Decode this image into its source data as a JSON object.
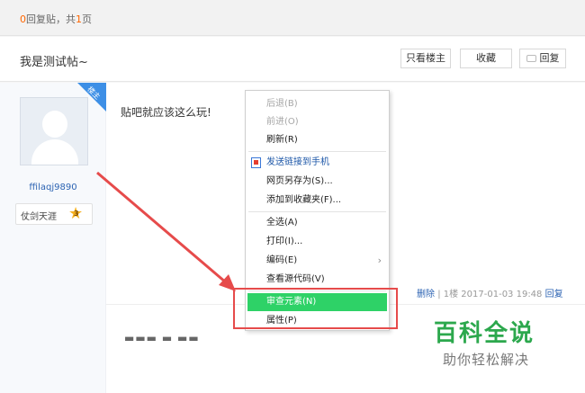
{
  "summary": {
    "reply_count": "0",
    "reply_label": "回复贴，共",
    "page_count": "1",
    "page_label": "页"
  },
  "thread": {
    "title": "我是测试帖~",
    "only_owner_label": "只看楼主",
    "favorite_label": "收藏",
    "reply_label": "回复"
  },
  "author": {
    "badge": "楼主",
    "username": "ffilaqj9890",
    "rank_title": "仗剑天涯",
    "rank_level": "3"
  },
  "post": {
    "text": "贴吧就应该这么玩!",
    "delete_label": "删除",
    "floor": "| 1楼",
    "timestamp": "2017-01-03 19:48",
    "reply_label": "回复"
  },
  "context_menu": {
    "items": [
      {
        "label": "后退(B)",
        "state": "disabled"
      },
      {
        "label": "前进(O)",
        "state": "disabled"
      },
      {
        "label": "刷新(R)",
        "state": "normal"
      },
      {
        "label": "发送链接到手机",
        "state": "link",
        "icon": "phone-icon"
      },
      {
        "label": "网页另存为(S)...",
        "state": "normal"
      },
      {
        "label": "添加到收藏夹(F)...",
        "state": "normal"
      },
      {
        "label": "全选(A)",
        "state": "normal"
      },
      {
        "label": "打印(I)...",
        "state": "normal"
      },
      {
        "label": "编码(E)",
        "state": "normal",
        "submenu": "›"
      },
      {
        "label": "查看源代码(V)",
        "state": "normal"
      },
      {
        "label": "审查元素(N)",
        "state": "selected"
      },
      {
        "label": "属性(P)",
        "state": "normal"
      }
    ]
  },
  "watermark": {
    "main": "百科全说",
    "sub": "助你轻松解决"
  },
  "colors": {
    "accent_green": "#2ed267",
    "highlight_red": "#e64b4b",
    "link_blue": "#2d64b3",
    "badge_blue": "#3d8fe6"
  }
}
